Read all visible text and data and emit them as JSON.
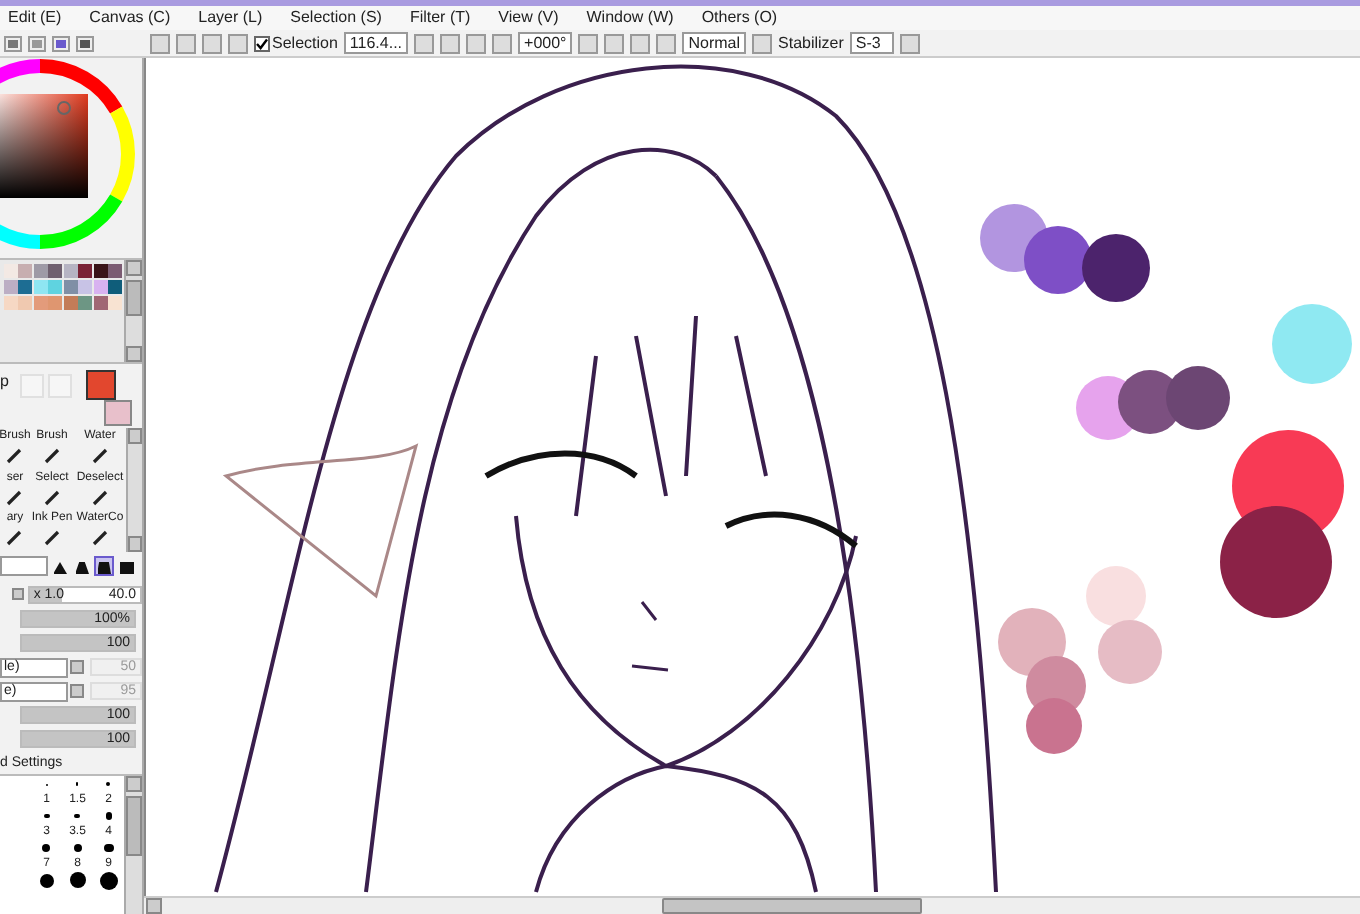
{
  "menu": [
    {
      "label": "Edit (E)"
    },
    {
      "label": "Canvas (C)"
    },
    {
      "label": "Layer (L)"
    },
    {
      "label": "Selection (S)"
    },
    {
      "label": "Filter (T)"
    },
    {
      "label": "View (V)"
    },
    {
      "label": "Window (W)"
    },
    {
      "label": "Others (O)"
    }
  ],
  "toolbar": {
    "selection_label": "Selection",
    "selection_checked": true,
    "zoom": "116.4...",
    "angle": "+000°",
    "blend_mode": "Normal",
    "stabilizer_label": "Stabilizer",
    "stabilizer": "S-3"
  },
  "palette": [
    {
      "color": "#f3e9e4"
    },
    {
      "color": "#c7aeb0"
    },
    {
      "color": "#9e9aa6"
    },
    {
      "color": "#6e5f6e"
    },
    {
      "color": "#b6b4c3"
    },
    {
      "color": "#7a2336"
    },
    {
      "color": "#3a1418"
    },
    {
      "color": "#7b5b72"
    },
    {
      "color": "#bcaec4"
    },
    {
      "color": "#1d6d93"
    },
    {
      "color": "#8fe6f2"
    },
    {
      "color": "#5fd3e0"
    },
    {
      "color": "#7f8fa6"
    },
    {
      "color": "#c8c3e6"
    },
    {
      "color": "#d8b2f0"
    },
    {
      "color": "#0f5d7a"
    },
    {
      "color": "#f6d8c4"
    },
    {
      "color": "#f0c9b0"
    },
    {
      "color": "#e39b7b"
    },
    {
      "color": "#df9670"
    },
    {
      "color": "#c37c58"
    },
    {
      "color": "#6d9684"
    },
    {
      "color": "#a06774"
    },
    {
      "color": "#f8e3d2"
    }
  ],
  "color_label": "p",
  "primary_color": {
    "color": "#e2472e"
  },
  "secondary_color": {
    "color": "#e8c0cb"
  },
  "tools": [
    {
      "label": "Brush"
    },
    {
      "label": "Brush"
    },
    {
      "label": "Water"
    },
    {
      "label": "ser"
    },
    {
      "label": "Select"
    },
    {
      "label": "Deselect"
    },
    {
      "label": "ary"
    },
    {
      "label": "Ink Pen"
    },
    {
      "label": "WaterCo"
    }
  ],
  "brush_shapes": [
    {
      "selected": false
    },
    {
      "selected": false
    },
    {
      "selected": true
    },
    {
      "selected": false
    }
  ],
  "size": {
    "multiplier": "x 1.0",
    "value": "40.0",
    "level": 0.3
  },
  "sliders": [
    {
      "kind": "bar",
      "value": "100%",
      "level": 1
    },
    {
      "kind": "bar",
      "value": "100",
      "level": 1
    },
    {
      "kind": "dropdown",
      "label": "le)",
      "value": "50",
      "disabled": true
    },
    {
      "kind": "dropdown",
      "label": "e)",
      "value": "95",
      "disabled": true
    },
    {
      "kind": "bar",
      "value": "100",
      "level": 1
    },
    {
      "kind": "bar",
      "value": "100",
      "level": 1
    }
  ],
  "settings_label": "d Settings",
  "brush_sizes": [
    "1",
    "1.5",
    "2",
    "3",
    "3.5",
    "4",
    "7",
    "8",
    "9"
  ]
}
